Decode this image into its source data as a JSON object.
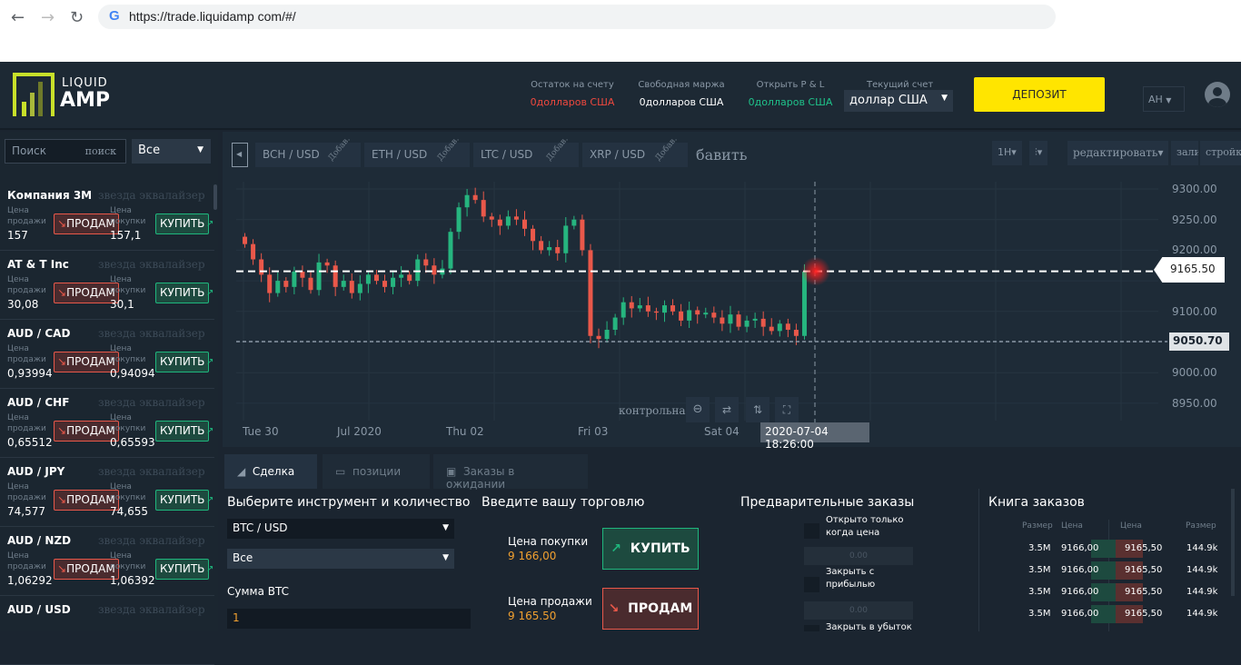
{
  "browser": {
    "url": "https://trade.liquidamp com/#/",
    "back": "←",
    "forward": "→",
    "reload": "↻",
    "g": "G"
  },
  "header": {
    "logo_top": "LIQUID",
    "logo_bottom": "AMP",
    "stats": [
      {
        "label": "Остаток на счету",
        "value": "0долларов США",
        "color": "#f0483e"
      },
      {
        "label": "Свободная маржа",
        "value": "0долларов США",
        "color": "#ffffff"
      },
      {
        "label": "Открыть P & L",
        "value": "0долларов США",
        "color": "#1fc28a"
      }
    ],
    "account_label": "Текущий счет",
    "account_value": "доллар США",
    "deposit": "ДЕПОЗИТ",
    "lang": "АН"
  },
  "sidebar": {
    "search_placeholder": "Поиск",
    "search_btn": "поиск",
    "filter": "Все",
    "sell_label": "Цена продажи",
    "buy_label": "Цена покупки",
    "sell_btn": "ПРОДАМ",
    "buy_btn": "КУПИТЬ",
    "ghost": "звезда эквалайзер",
    "instruments": [
      {
        "name": "Компания 3М",
        "sell": "157",
        "buy": "157,1"
      },
      {
        "name": "AT & T Inc",
        "sell": "30,08",
        "buy": "30,1"
      },
      {
        "name": "AUD / CAD",
        "sell": "0,93994",
        "buy": "0,94094"
      },
      {
        "name": "AUD / CHF",
        "sell": "0,65512",
        "buy": "0,65593"
      },
      {
        "name": "AUD / JPY",
        "sell": "74,577",
        "buy": "74,655"
      },
      {
        "name": "AUD / NZD",
        "sell": "1,06292",
        "buy": "1,06392"
      },
      {
        "name": "AUD / USD",
        "sell": "",
        "buy": ""
      }
    ]
  },
  "chart": {
    "tabs": [
      "BCH / USD",
      "ETH / USD",
      "LTC / USD",
      "XRP / USD"
    ],
    "tab_ghost": "Добав.",
    "add": "бавить",
    "interval": "1H▾",
    "type": "⫶▾",
    "edit": "редактировать▾",
    "fill": "залив",
    "settings": "стройки",
    "control": "контрольная",
    "y_ticks": [
      "9300.00",
      "9250.00",
      "9200.00",
      "9100.00",
      "9000.00",
      "8950.00"
    ],
    "y_tick_values": [
      9300,
      9250,
      9200,
      9100,
      9000,
      8950
    ],
    "x_ticks": [
      "Tue 30",
      "Jul 2020",
      "Thu 02",
      "Fri 03",
      "Sat 04"
    ],
    "current_price": "9165.50",
    "current_value": 9165.5,
    "cross_price": "9050.70",
    "cross_value": 9050.7,
    "cross_time": "2020-07-04 18:26:00",
    "first_open": 9222,
    "closes": [
      9210,
      9185,
      9160,
      9130,
      9150,
      9140,
      9165,
      9155,
      9135,
      9180,
      9175,
      9140,
      9150,
      9130,
      9145,
      9160,
      9150,
      9140,
      9155,
      9160,
      9150,
      9185,
      9175,
      9160,
      9170,
      9230,
      9270,
      9290,
      9282,
      9255,
      9250,
      9240,
      9255,
      9250,
      9235,
      9215,
      9200,
      9205,
      9195,
      9240,
      9250,
      9200,
      9060,
      9055,
      9070,
      9090,
      9115,
      9105,
      9110,
      9100,
      9098,
      9110,
      9100,
      9085,
      9102,
      9095,
      9098,
      9090,
      9080,
      9095,
      9075,
      9085,
      9088,
      9075,
      9068,
      9080,
      9070,
      9060,
      9165
    ],
    "colors": {
      "up": "#26b57f",
      "down": "#e9584a"
    }
  },
  "bottom": {
    "tabs": [
      "Сделка",
      "позиции",
      "Заказы в ожидании"
    ],
    "select_title": "Выберите инструмент и количество",
    "instrument": "BTC / USD",
    "group": "Все",
    "amount_label": "Сумма BTC",
    "amount": "1",
    "trade_title": "Введите вашу торговлю",
    "buy_price_label": "Цена покупки",
    "buy_price": "9 166,00",
    "buy_btn": "КУПИТЬ",
    "sell_price_label": "Цена продажи",
    "sell_price": "9 165.50",
    "sell_btn": "ПРОДАМ",
    "pre_title": "Предварительные заказы",
    "pre_opts": [
      "Открыто только когда цена",
      "Закрыть с прибылью",
      "Закрыть в убыток"
    ],
    "pre_ghost": "Цена",
    "pre_value": "0.00",
    "book_title": "Книга заказов",
    "book_headers": [
      "Размер",
      "Цена",
      "Цена",
      "Размер"
    ],
    "book_rows": [
      [
        "3.5M",
        "9166,00",
        "9165,50",
        "144.9k"
      ],
      [
        "3.5M",
        "9166,00",
        "9165,50",
        "144.9k"
      ],
      [
        "3.5M",
        "9166,00",
        "9165,50",
        "144.9k"
      ],
      [
        "3.5M",
        "9166,00",
        "9165,50",
        "144.9k"
      ]
    ]
  }
}
